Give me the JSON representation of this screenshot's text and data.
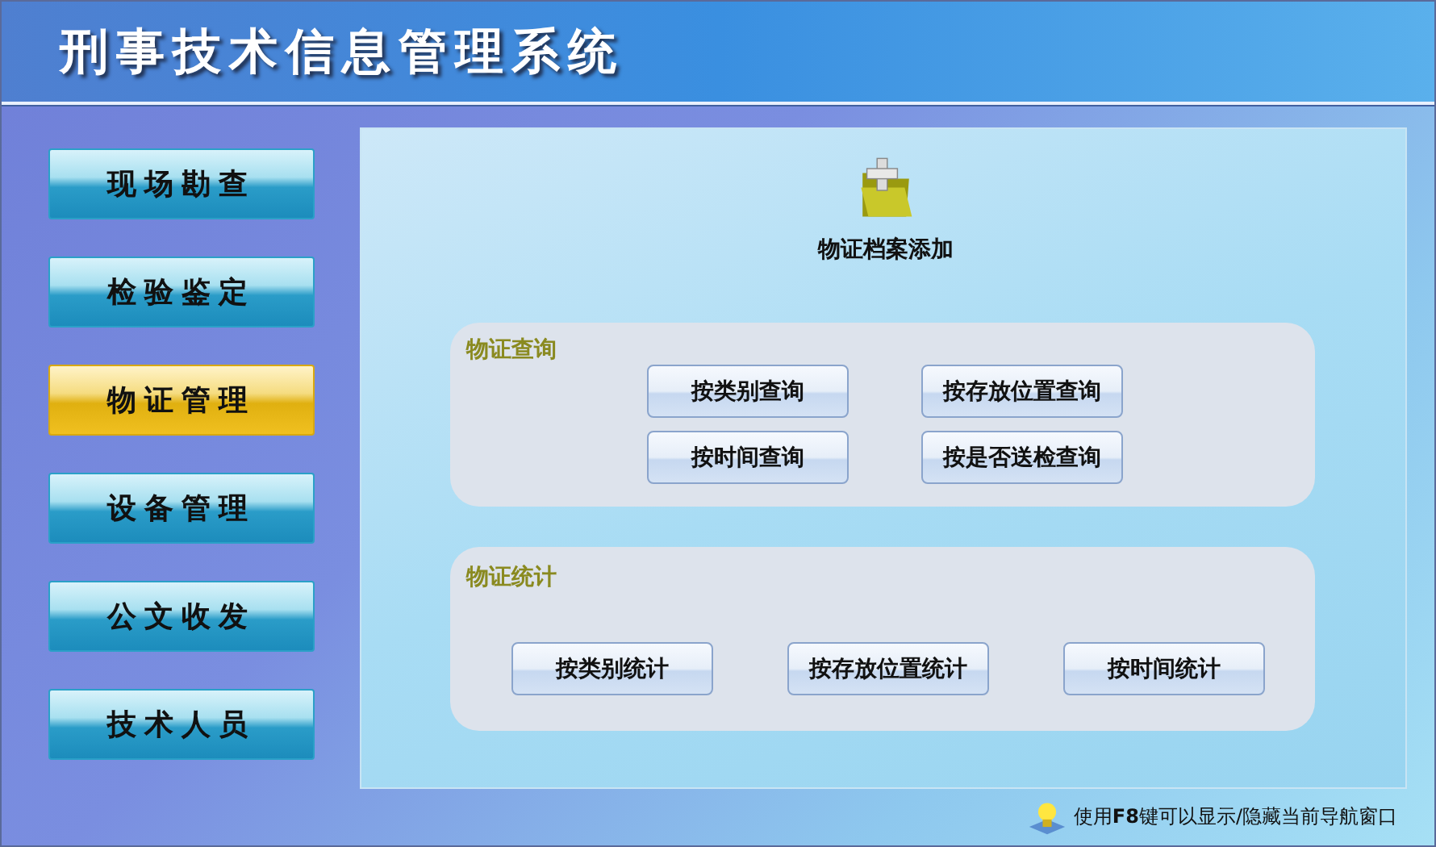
{
  "window": {
    "title": "刑事技术信息管理系统"
  },
  "sidebar": {
    "items": [
      {
        "label": "现场勘查",
        "selected": false
      },
      {
        "label": "检验鉴定",
        "selected": false
      },
      {
        "label": "物证管理",
        "selected": true
      },
      {
        "label": "设备管理",
        "selected": false
      },
      {
        "label": "公文收发",
        "selected": false
      },
      {
        "label": "技术人员",
        "selected": false
      }
    ]
  },
  "main": {
    "add_action": {
      "label": "物证档案添加"
    },
    "groups": [
      {
        "title": "物证查询",
        "buttons": [
          "按类别查询",
          "按存放位置查询",
          "按时间查询",
          "按是否送检查询"
        ]
      },
      {
        "title": "物证统计",
        "buttons": [
          "按类别统计",
          "按存放位置统计",
          "按时间统计"
        ]
      }
    ]
  },
  "status_bar": {
    "hint": "使用**F8**键可以显示/隐藏当前导航窗口"
  }
}
